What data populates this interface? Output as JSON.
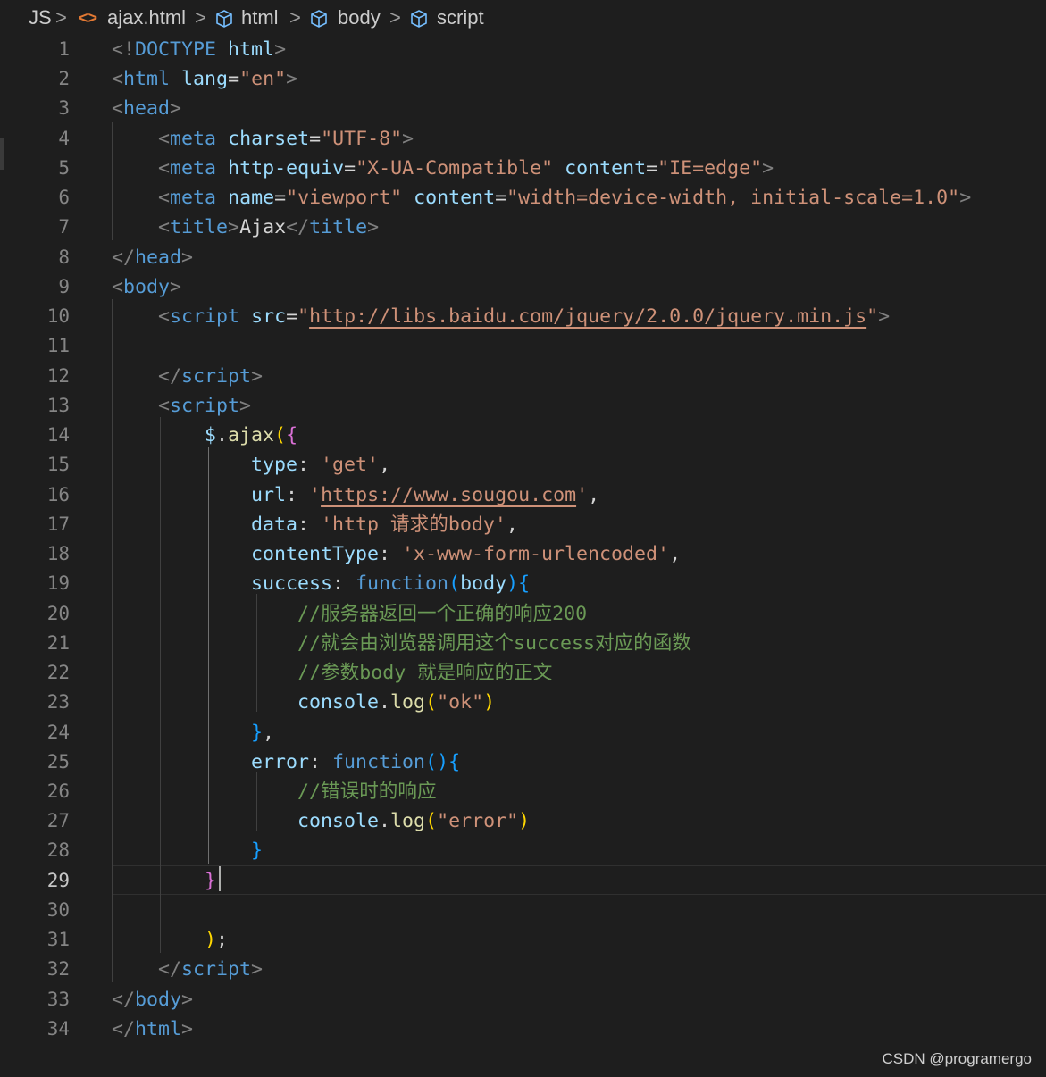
{
  "breadcrumb": {
    "root": "JS",
    "file": "ajax.html",
    "items": [
      "html",
      "body",
      "script"
    ]
  },
  "editor": {
    "current_line": 29,
    "lines": [
      [
        [
          "b",
          "<!"
        ],
        [
          "t",
          "DOCTYPE"
        ],
        [
          "x",
          " "
        ],
        [
          "a",
          "html"
        ],
        [
          "b",
          ">"
        ]
      ],
      [
        [
          "b",
          "<"
        ],
        [
          "t",
          "html"
        ],
        [
          "x",
          " "
        ],
        [
          "a",
          "lang"
        ],
        [
          "x",
          "="
        ],
        [
          "s",
          "\"en\""
        ],
        [
          "b",
          ">"
        ]
      ],
      [
        [
          "b",
          "<"
        ],
        [
          "t",
          "head"
        ],
        [
          "b",
          ">"
        ]
      ],
      [
        [
          "x",
          "    "
        ],
        [
          "b",
          "<"
        ],
        [
          "t",
          "meta"
        ],
        [
          "x",
          " "
        ],
        [
          "a",
          "charset"
        ],
        [
          "x",
          "="
        ],
        [
          "s",
          "\"UTF-8\""
        ],
        [
          "b",
          ">"
        ]
      ],
      [
        [
          "x",
          "    "
        ],
        [
          "b",
          "<"
        ],
        [
          "t",
          "meta"
        ],
        [
          "x",
          " "
        ],
        [
          "a",
          "http-equiv"
        ],
        [
          "x",
          "="
        ],
        [
          "s",
          "\"X-UA-Compatible\""
        ],
        [
          "x",
          " "
        ],
        [
          "a",
          "content"
        ],
        [
          "x",
          "="
        ],
        [
          "s",
          "\"IE=edge\""
        ],
        [
          "b",
          ">"
        ]
      ],
      [
        [
          "x",
          "    "
        ],
        [
          "b",
          "<"
        ],
        [
          "t",
          "meta"
        ],
        [
          "x",
          " "
        ],
        [
          "a",
          "name"
        ],
        [
          "x",
          "="
        ],
        [
          "s",
          "\"viewport\""
        ],
        [
          "x",
          " "
        ],
        [
          "a",
          "content"
        ],
        [
          "x",
          "="
        ],
        [
          "s",
          "\"width=device-width, initial-scale=1.0\""
        ],
        [
          "b",
          ">"
        ]
      ],
      [
        [
          "x",
          "    "
        ],
        [
          "b",
          "<"
        ],
        [
          "t",
          "title"
        ],
        [
          "b",
          ">"
        ],
        [
          "x",
          "Ajax"
        ],
        [
          "b",
          "</"
        ],
        [
          "t",
          "title"
        ],
        [
          "b",
          ">"
        ]
      ],
      [
        [
          "b",
          "</"
        ],
        [
          "t",
          "head"
        ],
        [
          "b",
          ">"
        ]
      ],
      [
        [
          "b",
          "<"
        ],
        [
          "t",
          "body"
        ],
        [
          "b",
          ">"
        ]
      ],
      [
        [
          "x",
          "    "
        ],
        [
          "b",
          "<"
        ],
        [
          "t",
          "script"
        ],
        [
          "x",
          " "
        ],
        [
          "a",
          "src"
        ],
        [
          "x",
          "="
        ],
        [
          "s",
          "\""
        ],
        [
          "su",
          "http://libs.baidu.com/jquery/2.0.0/jquery.min.js"
        ],
        [
          "s",
          "\""
        ],
        [
          "b",
          ">"
        ]
      ],
      [],
      [
        [
          "x",
          "    "
        ],
        [
          "b",
          "</"
        ],
        [
          "t",
          "script"
        ],
        [
          "b",
          ">"
        ]
      ],
      [
        [
          "x",
          "    "
        ],
        [
          "b",
          "<"
        ],
        [
          "t",
          "script"
        ],
        [
          "b",
          ">"
        ]
      ],
      [
        [
          "x",
          "        "
        ],
        [
          "a",
          "$"
        ],
        [
          "x",
          "."
        ],
        [
          "f",
          "ajax"
        ],
        [
          "y",
          "("
        ],
        [
          "m",
          "{"
        ]
      ],
      [
        [
          "x",
          "            "
        ],
        [
          "a",
          "type"
        ],
        [
          "x",
          ": "
        ],
        [
          "s",
          "'get'"
        ],
        [
          "x",
          ","
        ]
      ],
      [
        [
          "x",
          "            "
        ],
        [
          "a",
          "url"
        ],
        [
          "x",
          ": "
        ],
        [
          "s",
          "'"
        ],
        [
          "su",
          "https://www.sougou.com"
        ],
        [
          "s",
          "'"
        ],
        [
          "x",
          ","
        ]
      ],
      [
        [
          "x",
          "            "
        ],
        [
          "a",
          "data"
        ],
        [
          "x",
          ": "
        ],
        [
          "s",
          "'http 请求的body'"
        ],
        [
          "x",
          ","
        ]
      ],
      [
        [
          "x",
          "            "
        ],
        [
          "a",
          "contentType"
        ],
        [
          "x",
          ": "
        ],
        [
          "s",
          "'x-www-form-urlencoded'"
        ],
        [
          "x",
          ","
        ]
      ],
      [
        [
          "x",
          "            "
        ],
        [
          "a",
          "success"
        ],
        [
          "x",
          ": "
        ],
        [
          "t",
          "function"
        ],
        [
          "k",
          "("
        ],
        [
          "a",
          "body"
        ],
        [
          "k",
          ")"
        ],
        [
          "k",
          "{"
        ]
      ],
      [
        [
          "x",
          "                "
        ],
        [
          "c",
          "//服务器返回一个正确的响应200"
        ]
      ],
      [
        [
          "x",
          "                "
        ],
        [
          "c",
          "//就会由浏览器调用这个success对应的函数"
        ]
      ],
      [
        [
          "x",
          "                "
        ],
        [
          "c",
          "//参数body 就是响应的正文"
        ]
      ],
      [
        [
          "x",
          "                "
        ],
        [
          "a",
          "console"
        ],
        [
          "x",
          "."
        ],
        [
          "f",
          "log"
        ],
        [
          "y",
          "("
        ],
        [
          "s",
          "\"ok\""
        ],
        [
          "y",
          ")"
        ]
      ],
      [
        [
          "x",
          "            "
        ],
        [
          "k",
          "}"
        ],
        [
          "x",
          ","
        ]
      ],
      [
        [
          "x",
          "            "
        ],
        [
          "a",
          "error"
        ],
        [
          "x",
          ": "
        ],
        [
          "t",
          "function"
        ],
        [
          "k",
          "("
        ],
        [
          "k",
          ")"
        ],
        [
          "k",
          "{"
        ]
      ],
      [
        [
          "x",
          "                "
        ],
        [
          "c",
          "//错误时的响应"
        ]
      ],
      [
        [
          "x",
          "                "
        ],
        [
          "a",
          "console"
        ],
        [
          "x",
          "."
        ],
        [
          "f",
          "log"
        ],
        [
          "y",
          "("
        ],
        [
          "s",
          "\"error\""
        ],
        [
          "y",
          ")"
        ]
      ],
      [
        [
          "x",
          "            "
        ],
        [
          "k",
          "}"
        ]
      ],
      [
        [
          "x",
          "        "
        ],
        [
          "m",
          "}"
        ]
      ],
      [],
      [
        [
          "x",
          "        "
        ],
        [
          "y",
          ")"
        ],
        [
          "x",
          ";"
        ]
      ],
      [
        [
          "x",
          "    "
        ],
        [
          "b",
          "</"
        ],
        [
          "t",
          "script"
        ],
        [
          "b",
          ">"
        ]
      ],
      [
        [
          "b",
          "</"
        ],
        [
          "t",
          "body"
        ],
        [
          "b",
          ">"
        ]
      ],
      [
        [
          "b",
          "</"
        ],
        [
          "t",
          "html"
        ],
        [
          "b",
          ">"
        ]
      ]
    ]
  },
  "watermark": "CSDN @programergo"
}
